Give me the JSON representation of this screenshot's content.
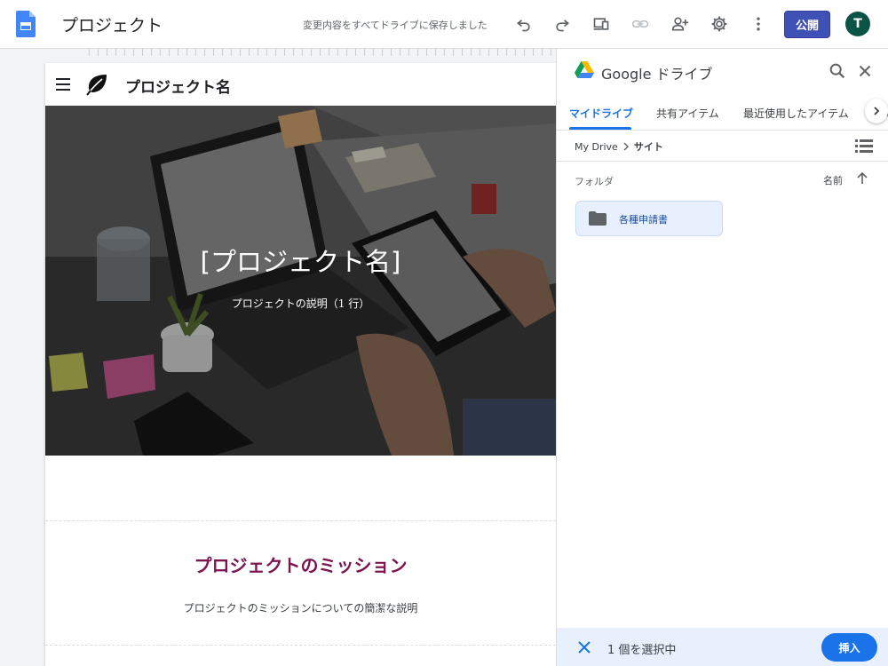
{
  "app": {
    "title": "プロジェクト",
    "save_status": "変更内容をすべてドライブに保存しました",
    "publish_label": "公開",
    "avatar_initial": "T",
    "brand_color": "#3f51b5"
  },
  "site": {
    "name": "プロジェクト名",
    "hero_title": "[プロジェクト名]",
    "hero_subtitle": "プロジェクトの説明（1 行）",
    "mission_title": "プロジェクトのミッション",
    "mission_desc": "プロジェクトのミッションについての簡潔な説明",
    "accent_color": "#7b1450"
  },
  "drive_panel": {
    "title": "Google ドライブ",
    "tabs": [
      {
        "label": "マイドライブ",
        "active": true
      },
      {
        "label": "共有アイテム",
        "active": false
      },
      {
        "label": "最近使用したアイテム",
        "active": false
      },
      {
        "label": "タ",
        "active": false
      }
    ],
    "breadcrumb": [
      "My Drive",
      "サイト"
    ],
    "section_label": "フォルダ",
    "sort_label": "名前",
    "folders": [
      {
        "name": "各種申請書",
        "selected": true
      }
    ],
    "footer": {
      "selected_count": "1 個を選択中",
      "insert_label": "挿入"
    }
  }
}
